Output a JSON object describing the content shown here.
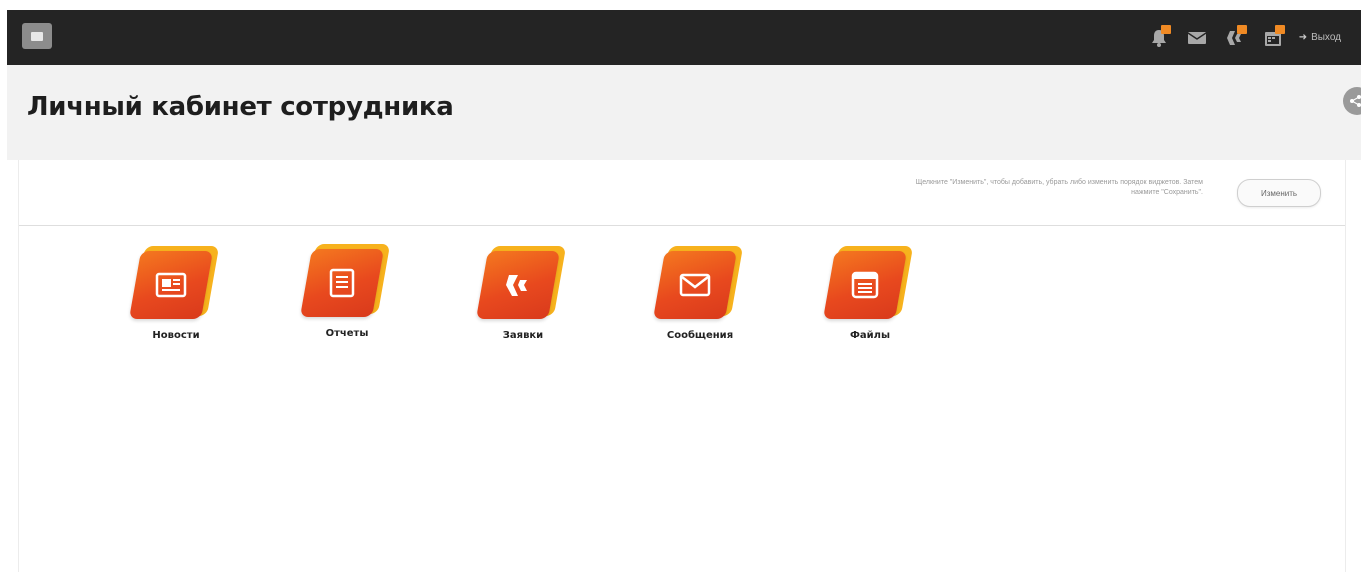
{
  "topbar": {
    "menu_icon": "menu-square-icon",
    "icons": [
      {
        "name": "bell-icon",
        "badge_color": "#f08a24"
      },
      {
        "name": "mail-icon"
      },
      {
        "name": "requests-icon",
        "badge_color": "#f08a24"
      },
      {
        "name": "calendar-icon",
        "badge_color": "#f08a24"
      }
    ],
    "logout_label": "Выход"
  },
  "header": {
    "title": "Личный кабинет сотрудника",
    "share_icon": "share-icon"
  },
  "panel": {
    "hint_text": "Щелкните \"Изменить\", чтобы добавить, убрать либо изменить порядок виджетов. Затем нажмите \"Сохранить\".",
    "change_button_label": "Изменить",
    "tiles": [
      {
        "label": "Новости",
        "icon": "newspaper-icon"
      },
      {
        "label": "Отчеты",
        "icon": "report-icon"
      },
      {
        "label": "Заявки",
        "icon": "requests-icon"
      },
      {
        "label": "Сообщения",
        "icon": "envelope-icon"
      },
      {
        "label": "Файлы",
        "icon": "files-icon"
      }
    ]
  },
  "colors": {
    "accent_orange": "#e8491e",
    "accent_yellow": "#f7b21d",
    "topbar_bg": "#242424"
  }
}
